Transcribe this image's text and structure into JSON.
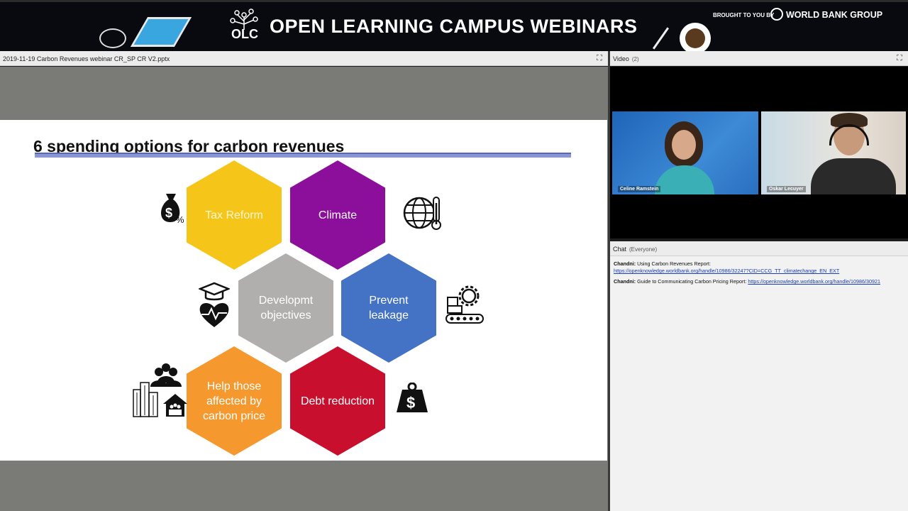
{
  "banner": {
    "title": "OPEN LEARNING CAMPUS WEBINARS",
    "olc_logo_text": "OLC",
    "brought_by": "BROUGHT TO YOU BY",
    "sponsor": "WORLD BANK GROUP"
  },
  "share_pod": {
    "title": "2019-11-19 Carbon Revenues webinar CR_SP CR V2.pptx"
  },
  "slide": {
    "title": "6 spending options for carbon revenues",
    "hexagons": [
      {
        "label": "Tax Reform",
        "color": "#f5c519"
      },
      {
        "label": "Climate",
        "color": "#8c0f9c"
      },
      {
        "label": "Developmt objectives",
        "color": "#b1aeae"
      },
      {
        "label": "Prevent leakage",
        "color": "#4472c4"
      },
      {
        "label": "Help those affected by carbon price",
        "color": "#f5982e"
      },
      {
        "label": "Debt reduction",
        "color": "#c8102e"
      }
    ],
    "icons": [
      "money-bag-icon",
      "globe-thermometer-icon",
      "graduation-heart-icon",
      "factory-gear-icon",
      "community-icon",
      "debt-weight-icon"
    ]
  },
  "video_pod": {
    "title": "Video",
    "count": "(2)",
    "participants": [
      {
        "name": "Celine Ramstein"
      },
      {
        "name": "Oskar Lecuyer"
      }
    ]
  },
  "chat_pod": {
    "title": "Chat",
    "scope": "(Everyone)",
    "messages": [
      {
        "sender": "Chandni:",
        "text": "Using Carbon Revenues Report:",
        "link": "https://openknowledge.worldbank.org/handle/10986/32247?CID=CCG_TT_climatechange_EN_EXT"
      },
      {
        "sender": "Chandni:",
        "text": "Guide to Communicating Carbon Pricing Report:",
        "link": "https://openknowledge.worldbank.org/handle/10986/30921"
      }
    ]
  }
}
